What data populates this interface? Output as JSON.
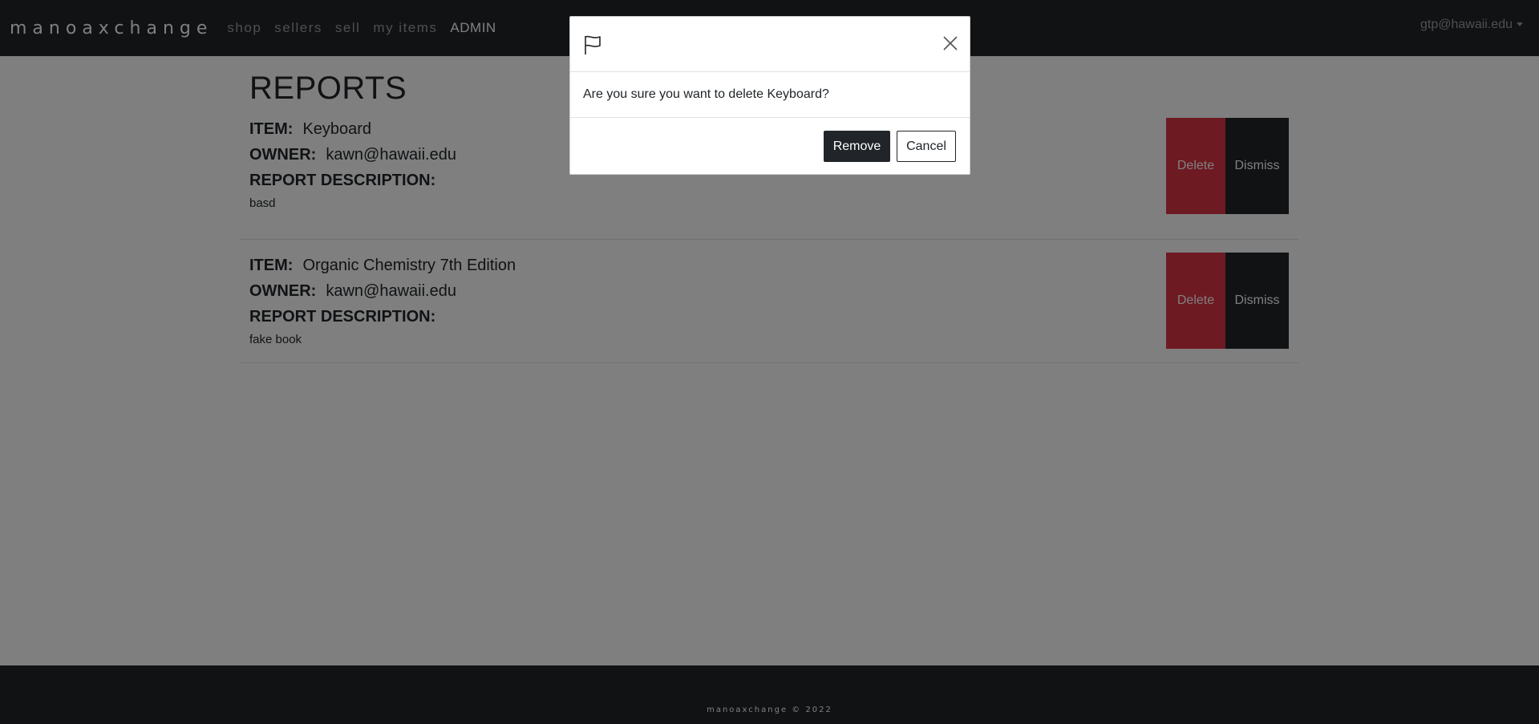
{
  "navbar": {
    "brand": "manoaxchange",
    "links": [
      "shop",
      "sellers",
      "sell",
      "my items",
      "ADMIN"
    ],
    "user": "gtp@hawaii.edu"
  },
  "page": {
    "title": "REPORTS"
  },
  "labels": {
    "item": "ITEM:",
    "owner": "OWNER:",
    "description": "REPORT DESCRIPTION:",
    "delete": "Delete",
    "dismiss": "Dismiss"
  },
  "reports": [
    {
      "item": "Keyboard",
      "owner": "kawn@hawaii.edu",
      "description": "basd"
    },
    {
      "item": "Organic Chemistry 7th Edition",
      "owner": "kawn@hawaii.edu",
      "description": "fake book"
    }
  ],
  "modal": {
    "icon": "flag-icon",
    "message": "Are you sure you want to delete Keyboard?",
    "confirm_label": "Remove",
    "cancel_label": "Cancel"
  },
  "footer": {
    "text": "manoaxchange © 2022"
  },
  "colors": {
    "navbar": "#212529",
    "danger": "#dc3545",
    "overlay": "rgba(0,0,0,0.5)"
  }
}
